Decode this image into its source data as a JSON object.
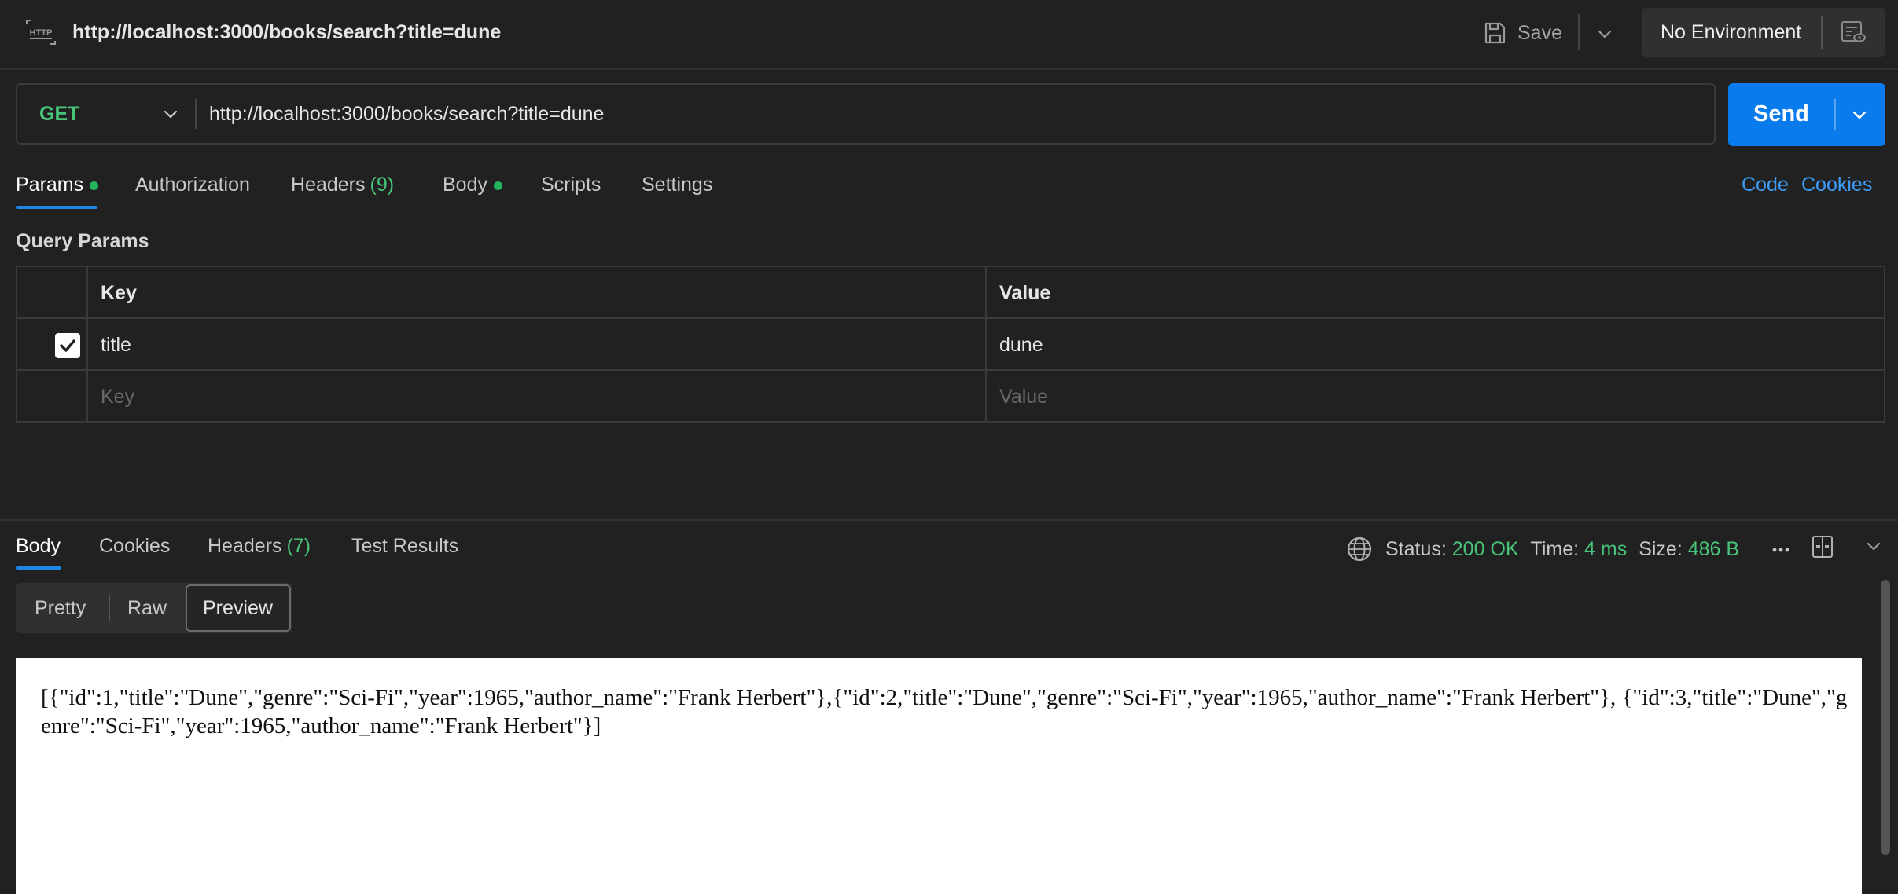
{
  "topbar": {
    "url": "http://localhost:3000/books/search?title=dune",
    "save_label": "Save",
    "environment": "No Environment"
  },
  "request": {
    "method": "GET",
    "url": "http://localhost:3000/books/search?title=dune",
    "send_label": "Send"
  },
  "tabs": {
    "params": "Params",
    "authorization": "Authorization",
    "headers": "Headers",
    "headers_count": "(9)",
    "body": "Body",
    "scripts": "Scripts",
    "settings": "Settings",
    "code": "Code",
    "cookies": "Cookies"
  },
  "query_params": {
    "title": "Query Params",
    "col_key": "Key",
    "col_value": "Value",
    "rows": [
      {
        "key": "title",
        "value": "dune",
        "checked": true
      }
    ],
    "placeholder_key": "Key",
    "placeholder_value": "Value"
  },
  "response": {
    "tabs": {
      "body": "Body",
      "cookies": "Cookies",
      "headers": "Headers",
      "headers_count": "(7)",
      "test_results": "Test Results"
    },
    "status_label": "Status:",
    "status_value": "200 OK",
    "time_label": "Time:",
    "time_value": "4 ms",
    "size_label": "Size:",
    "size_value": "486 B",
    "view_modes": {
      "pretty": "Pretty",
      "raw": "Raw",
      "preview": "Preview"
    },
    "body_text": "[{\"id\":1,\"title\":\"Dune\",\"genre\":\"Sci-Fi\",\"year\":1965,\"author_name\":\"Frank Herbert\"},{\"id\":2,\"title\":\"Dune\",\"genre\":\"Sci-Fi\",\"year\":1965,\"author_name\":\"Frank Herbert\"}, {\"id\":3,\"title\":\"Dune\",\"genre\":\"Sci-Fi\",\"year\":1965,\"author_name\":\"Frank Herbert\"}]"
  },
  "colors": {
    "background": "#212121",
    "accent_blue": "#097bed",
    "method_green": "#47c479",
    "dot_green": "#22b55b",
    "link_blue": "#3d9cf5"
  },
  "icons": [
    "http-icon",
    "save-icon",
    "chevron-down-icon",
    "eye-icon",
    "globe-icon",
    "more-icon",
    "layout-icon",
    "check-icon"
  ]
}
